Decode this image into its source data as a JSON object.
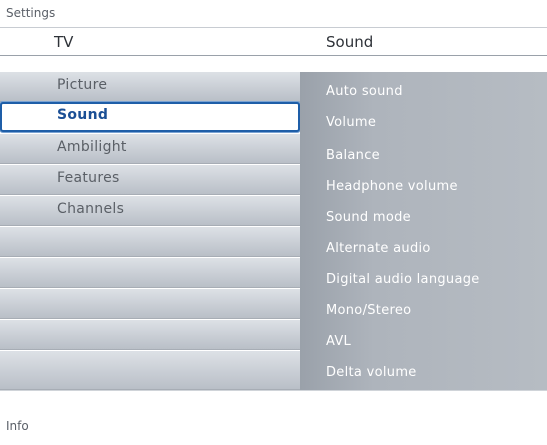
{
  "title": "Settings",
  "header": {
    "left": "TV",
    "right": "Sound"
  },
  "left_menu": {
    "items": [
      {
        "label": "Picture",
        "selected": false
      },
      {
        "label": "Sound",
        "selected": true
      },
      {
        "label": "Ambilight",
        "selected": false
      },
      {
        "label": "Features",
        "selected": false
      },
      {
        "label": "Channels",
        "selected": false
      },
      {
        "label": "",
        "selected": false
      },
      {
        "label": "",
        "selected": false
      },
      {
        "label": "",
        "selected": false
      },
      {
        "label": "",
        "selected": false
      },
      {
        "label": "",
        "selected": false
      }
    ]
  },
  "right_menu": {
    "items": [
      {
        "label": "Auto sound"
      },
      {
        "label": "Volume"
      },
      {
        "label": "Balance"
      },
      {
        "label": "Headphone volume"
      },
      {
        "label": "Sound mode"
      },
      {
        "label": "Alternate audio"
      },
      {
        "label": "Digital audio language"
      },
      {
        "label": "Mono/Stereo"
      },
      {
        "label": "AVL"
      },
      {
        "label": "Delta volume"
      }
    ]
  },
  "info": "Info",
  "colors": {
    "selected_border": "#1e5ea8",
    "selected_text": "#1b4f95",
    "right_panel": "#aeb4bc"
  }
}
